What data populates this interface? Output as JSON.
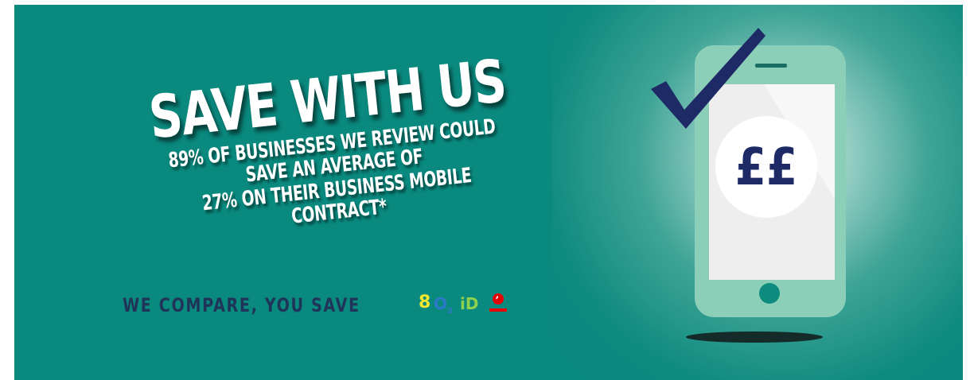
{
  "headline": "SAVE WITH US",
  "subline": {
    "line1": "89% OF BUSINESSES WE REVIEW COULD SAVE AN AVERAGE OF",
    "line2": "27% ON THEIR BUSINESS MOBILE CONTRACT*"
  },
  "tagline": "WE COMPARE, YOU SAVE",
  "networks": {
    "ee": "8",
    "o2": "O",
    "o2_sub": "2",
    "id": "iD"
  },
  "phone_screen_text": "££",
  "colors": {
    "background": "#0a8a7f",
    "phone_body": "#8ccfb8",
    "phone_screen": "#eeeeee",
    "checkmark": "#1e2a66",
    "tagline": "#1f3458",
    "currency": "#1e2a66"
  },
  "icons": [
    "checkmark-icon",
    "smartphone-icon",
    "ee-logo",
    "o2-logo",
    "id-mobile-logo",
    "vodafone-logo"
  ]
}
